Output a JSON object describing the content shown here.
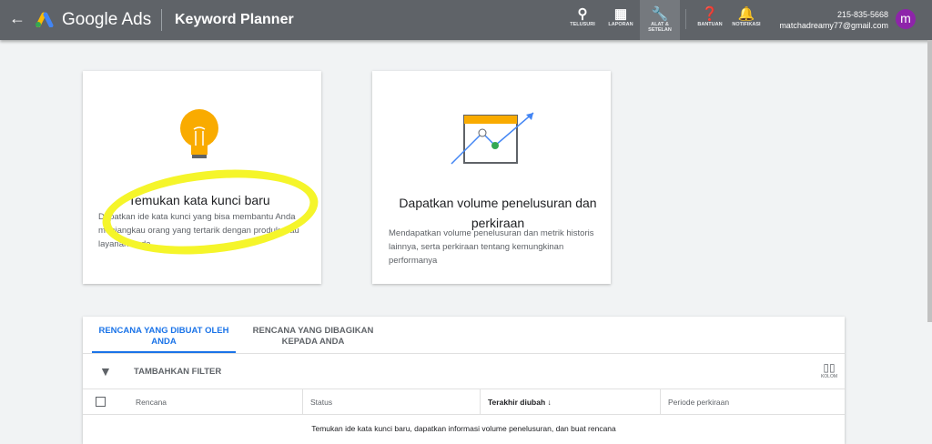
{
  "header": {
    "brand": "Google Ads",
    "tool": "Keyword Planner",
    "phone": "215-835-5668",
    "email": "matchadreamy77@gmail.com",
    "avatar": "m",
    "nav": [
      {
        "label": "TELUSURI",
        "icon": "search-icon"
      },
      {
        "label": "LAPORAN",
        "icon": "reports-icon"
      },
      {
        "label": "ALAT & SETELAN",
        "icon": "wrench-icon",
        "active": true
      },
      {
        "label": "BANTUAN",
        "icon": "help-icon"
      },
      {
        "label": "NOTIFIKASI",
        "icon": "bell-icon"
      }
    ]
  },
  "cards": [
    {
      "title": "Temukan kata kunci baru",
      "desc": "Dapatkan ide kata kunci yang bisa membantu Anda menjangkau orang yang tertarik dengan produk atau layanan Anda"
    },
    {
      "title": "Dapatkan volume penelusuran dan perkiraan",
      "desc": "Mendapatkan volume penelusuran dan metrik historis lainnya, serta perkiraan tentang kemungkinan performanya"
    }
  ],
  "plans": {
    "tabs": [
      "RENCANA YANG DIBUAT OLEH ANDA",
      "RENCANA YANG DIBAGIKAN KEPADA ANDA"
    ],
    "filter": "TAMBAHKAN FILTER",
    "columns_label": "KOLOM",
    "headers": [
      "Rencana",
      "Status",
      "Terakhir diubah",
      "Periode perkiraan"
    ],
    "empty": "Temukan ide kata kunci baru, dapatkan informasi volume penelusuran, dan buat rencana"
  },
  "colors": {
    "accent": "#1a73e8",
    "header": "#5f6368",
    "highlight": "#f5f52a"
  }
}
